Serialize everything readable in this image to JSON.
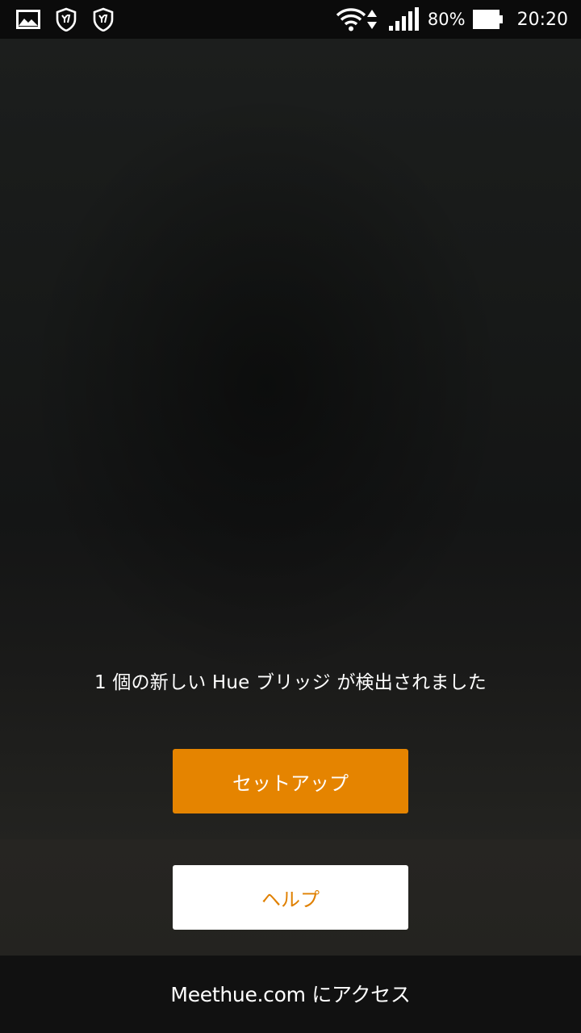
{
  "status_bar": {
    "battery_percent": "80%",
    "time": "20:20",
    "icons": [
      "gallery-icon",
      "shield-y-icon",
      "shield-y-icon",
      "wifi-icon",
      "data-arrows-icon",
      "signal-icon",
      "battery-icon"
    ]
  },
  "main": {
    "message": "1 個の新しい Hue ブリッジ が検出されました",
    "setup_button_label": "セットアップ",
    "help_button_label": "ヘルプ"
  },
  "footer": {
    "link_label": "Meethue.com にアクセス"
  },
  "colors": {
    "accent": "#e58400",
    "background": "#151716",
    "status_bar": "#0b0b0b",
    "help_text": "#e08000"
  }
}
